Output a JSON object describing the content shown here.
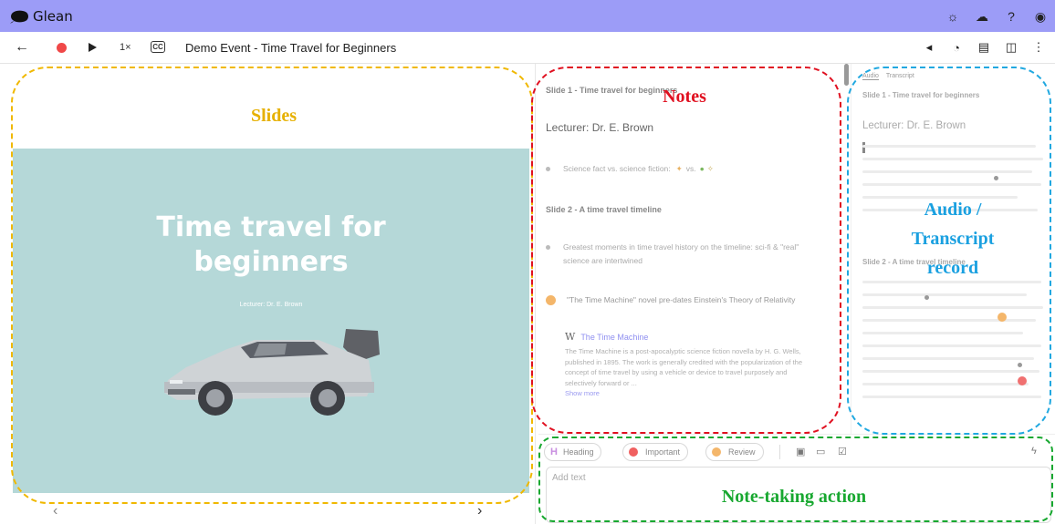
{
  "app": {
    "name": "Glean"
  },
  "toolbar": {
    "back_icon": "arrow-left-icon",
    "speed": "1×",
    "cc_label": "CC",
    "title": "Demo Event - Time Travel for Beginners"
  },
  "slide": {
    "title_line1": "Time travel for",
    "title_line2": "beginners",
    "lecturer": "Lecturer: Dr. E. Brown",
    "prev": "‹",
    "next": "›"
  },
  "notes": {
    "slide1_heading": "Slide 1 - Time travel for beginners",
    "lecturer": "Lecturer: Dr. E. Brown",
    "bullet1": "Science fact vs. science fiction:",
    "bullet1_vs": "vs.",
    "slide2_heading": "Slide 2 - A time travel timeline",
    "bullet2": "Greatest moments in time travel history on the timeline: sci-fi & \"real\" science are intertwined",
    "bullet3": "\"The Time Machine\" novel pre-dates Einstein's Theory of Relativity",
    "wiki": {
      "icon_letter": "W",
      "title": "The Time Machine",
      "body": "The Time Machine is a post-apocalyptic science fiction novella by H. G. Wells, published in 1895. The work is generally credited with the popularization of the concept of time travel by using a vehicle or device to travel purposely and selectively forward or ...",
      "more": "Show more"
    }
  },
  "audio": {
    "tab_audio": "Audio",
    "tab_transcript": "Transcript",
    "slide1_heading": "Slide 1 - Time travel for beginners",
    "lecturer": "Lecturer: Dr. E. Brown",
    "slide2_heading": "Slide 2 - A time travel timeline"
  },
  "editor": {
    "heading_label": "Heading",
    "important_label": "Important",
    "review_label": "Review",
    "placeholder": "Add text"
  },
  "annotations": {
    "slides": "Slides",
    "notes": "Notes",
    "audio_line1": "Audio /",
    "audio_line2": "Transcript",
    "audio_line3": "record",
    "note_taking": "Note-taking action"
  },
  "colors": {
    "header": "#9c9cf7",
    "slide_bg": "#b5d8d8",
    "slides_annotation": "#f0b800",
    "notes_annotation": "#e01020",
    "audio_annotation": "#20a8e0",
    "note_taking_annotation": "#18a830"
  }
}
